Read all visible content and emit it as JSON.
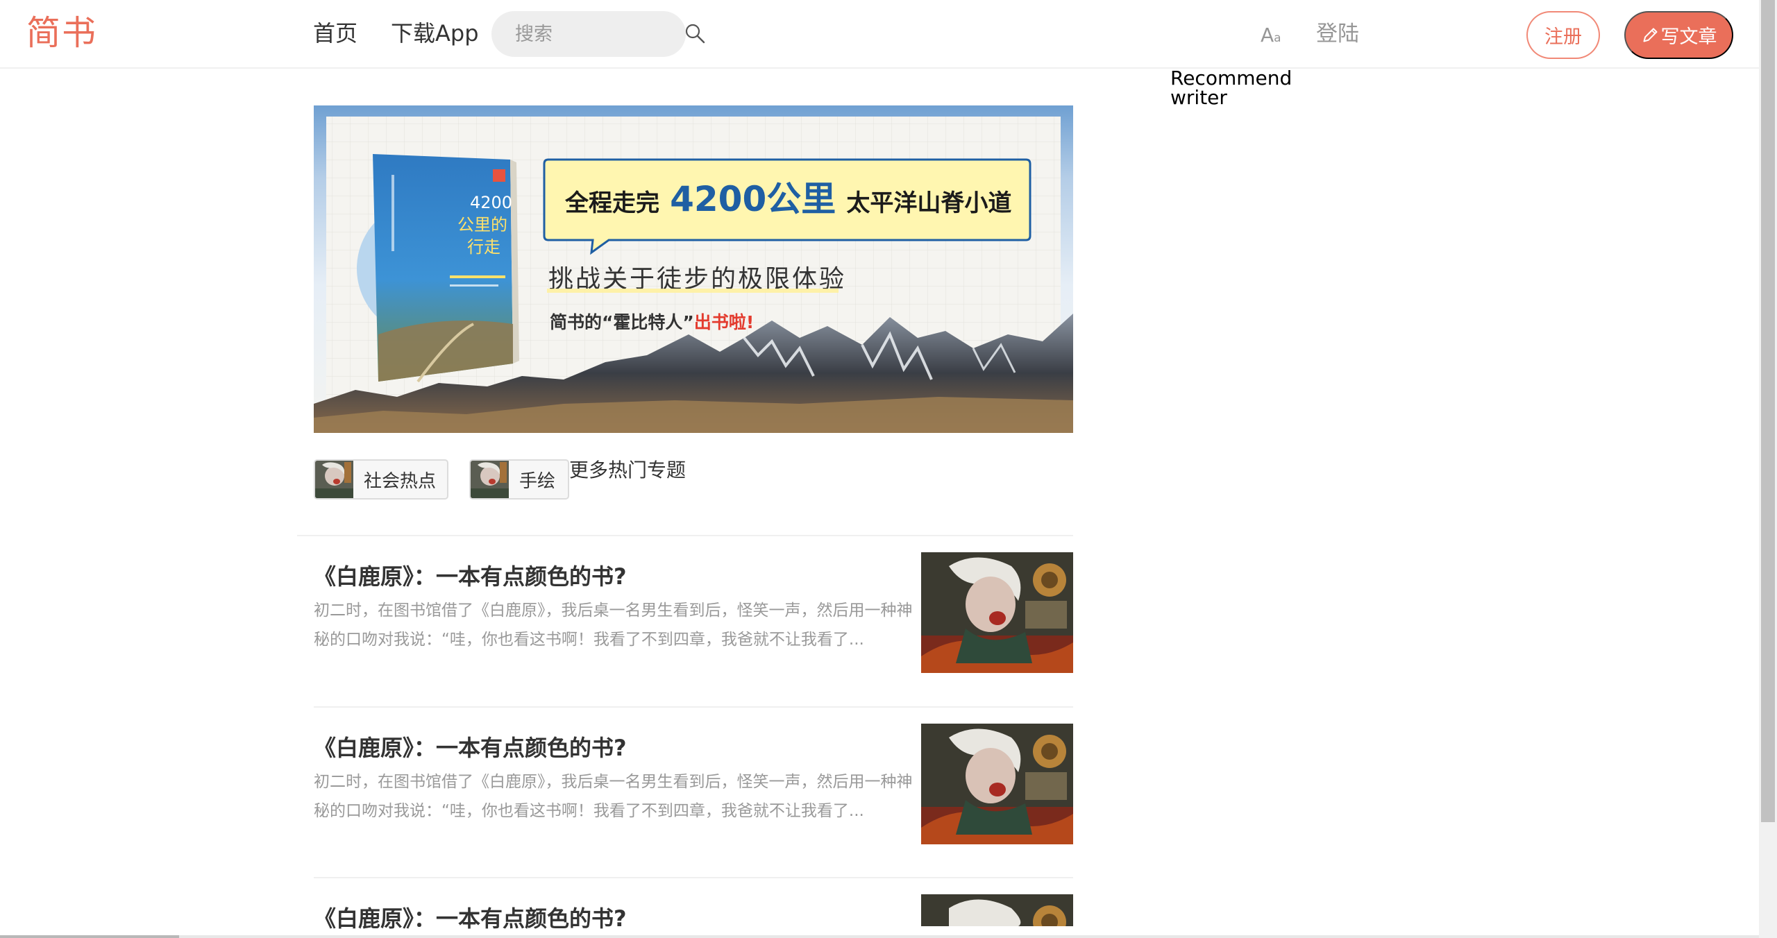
{
  "header": {
    "logo": "简书",
    "nav": {
      "home": "首页",
      "download_app": "下载App"
    },
    "search_placeholder": "搜索",
    "font_toggle": {
      "big": "A",
      "small": "a"
    },
    "login": "登陆",
    "register": "注册",
    "write": "写文章"
  },
  "banner": {
    "book_cover_title": [
      "4200",
      "公里的",
      "行走"
    ],
    "headline_prefix": "全程走完",
    "headline_highlight": "4200公里",
    "headline_suffix": "太平洋山脊小道",
    "subtitle": "挑战关于徒步的极限体验",
    "tagline_main": "简书的“霍比特人”",
    "tagline_accent": "出书啦!"
  },
  "topics": [
    {
      "label": "社会热点"
    },
    {
      "label": "手绘"
    }
  ],
  "more_topics": "更多热门专题",
  "articles": [
    {
      "title": "《白鹿原》：一本有点颜色的书?",
      "abstract": "初二时，在图书馆借了《白鹿原》，我后桌一名男生看到后，怪笑一声，然后用一种神秘的口吻对我说：“哇，你也看这书啊！我看了不到四章，我爸就不让我看了..."
    },
    {
      "title": "《白鹿原》：一本有点颜色的书?",
      "abstract": "初二时，在图书馆借了《白鹿原》，我后桌一名男生看到后，怪笑一声，然后用一种神秘的口吻对我说：“哇，你也看这书啊！我看了不到四章，我爸就不让我看了..."
    },
    {
      "title": "《白鹿原》：一本有点颜色的书?",
      "abstract": ""
    }
  ],
  "side": {
    "recommend_writer": "Recommend writer"
  },
  "colors": {
    "brand": "#ea6f5a",
    "banner_blue": "#1f5fa3",
    "banner_yellow": "#fff6b0",
    "banner_red": "#e33b2e"
  },
  "icons": {
    "search": "search-icon",
    "font_size": "font-size-icon",
    "write": "pencil-icon"
  }
}
